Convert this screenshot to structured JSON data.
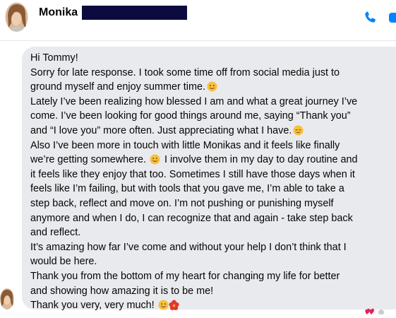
{
  "header": {
    "contact_name": "Monika",
    "call_icon": "phone-icon",
    "video_icon": "video-camera-icon"
  },
  "message": {
    "lines": [
      "Hi Tommy!",
      "Sorry for late response. I took some time off from social media just to",
      "ground myself and enjoy summer time.",
      "Lately I’ve been realizing how blessed I am and what a great journey I’ve",
      "come. I’ve been looking for good things around me, saying “Thank you”",
      "and “I love you” more often. Just appreciating what I have.",
      "Also I’ve been more in touch with little Monikas and it feels like finally",
      "we’re getting somewhere.",
      " I involve them in my day to day routine and",
      "it feels like they enjoy that too. Sometimes I still have those days when it",
      "feels like I’m failing, but with tools that you gave me, I’m able to take a",
      "step back, reflect and move on. I’m not pushing or punishing myself",
      "anymore and when I do, I can recognize that and again - take step back",
      "and reflect.",
      "It’s amazing how far I’ve come and without your help I don’t think that I",
      "would be here.",
      "Thank you from the bottom of my heart for changing my life for better",
      "and showing how amazing it is to be me!",
      "Thank you very, very much!"
    ]
  },
  "colors": {
    "bubble": "#e9eaed",
    "accent": "#0084ff",
    "redaction": "#0c0a3e"
  }
}
